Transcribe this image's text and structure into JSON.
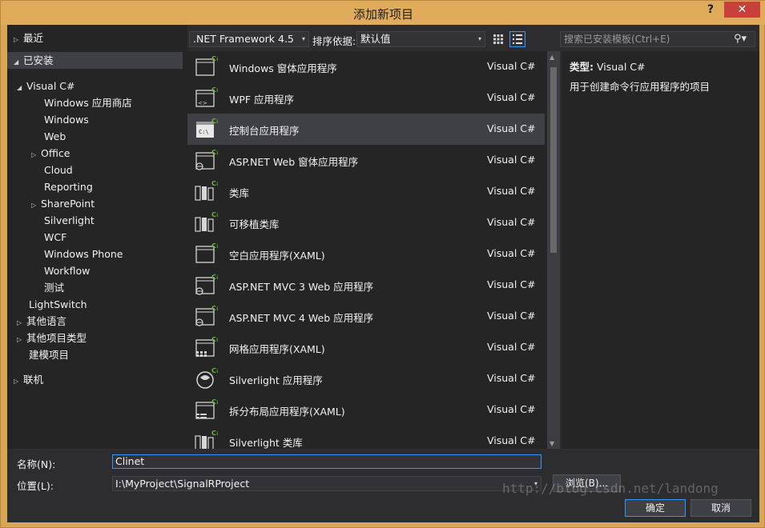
{
  "window": {
    "title": "添加新项目",
    "help": "?",
    "close": "✕"
  },
  "tree": [
    {
      "label": "最近",
      "arrow": "▷"
    },
    {
      "label": "已安装",
      "arrow": "◢"
    },
    {
      "label": "Visual C#",
      "arrow": "◢"
    },
    {
      "label": "Windows 应用商店",
      "arrow": ""
    },
    {
      "label": "Windows",
      "arrow": ""
    },
    {
      "label": "Web",
      "arrow": ""
    },
    {
      "label": "Office",
      "arrow": "▷"
    },
    {
      "label": "Cloud",
      "arrow": ""
    },
    {
      "label": "Reporting",
      "arrow": ""
    },
    {
      "label": "SharePoint",
      "arrow": "▷"
    },
    {
      "label": "Silverlight",
      "arrow": ""
    },
    {
      "label": "WCF",
      "arrow": ""
    },
    {
      "label": "Windows Phone",
      "arrow": ""
    },
    {
      "label": "Workflow",
      "arrow": ""
    },
    {
      "label": "测试",
      "arrow": ""
    },
    {
      "label": "LightSwitch",
      "arrow": ""
    },
    {
      "label": "其他语言",
      "arrow": "▷"
    },
    {
      "label": "其他项目类型",
      "arrow": "▷"
    },
    {
      "label": "建模项目",
      "arrow": ""
    },
    {
      "label": "联机",
      "arrow": "▷"
    }
  ],
  "toolbar": {
    "framework": ".NET Framework 4.5",
    "sort_label": "排序依据:",
    "sort_value": "默认值",
    "search_placeholder": "搜索已安装模板(Ctrl+E)",
    "dropdown_arrow": "▾"
  },
  "templates": [
    {
      "name": "Windows 窗体应用程序",
      "lang": "Visual C#",
      "icon": "windows-form-icon"
    },
    {
      "name": "WPF 应用程序",
      "lang": "Visual C#",
      "icon": "wpf-app-icon"
    },
    {
      "name": "控制台应用程序",
      "lang": "Visual C#",
      "icon": "console-app-icon"
    },
    {
      "name": "ASP.NET Web 窗体应用程序",
      "lang": "Visual C#",
      "icon": "web-form-icon"
    },
    {
      "name": "类库",
      "lang": "Visual C#",
      "icon": "class-library-icon"
    },
    {
      "name": "可移植类库",
      "lang": "Visual C#",
      "icon": "portable-library-icon"
    },
    {
      "name": "空白应用程序(XAML)",
      "lang": "Visual C#",
      "icon": "blank-app-icon"
    },
    {
      "name": "ASP.NET MVC 3 Web 应用程序",
      "lang": "Visual C#",
      "icon": "mvc3-icon"
    },
    {
      "name": "ASP.NET MVC 4 Web 应用程序",
      "lang": "Visual C#",
      "icon": "mvc4-icon"
    },
    {
      "name": "网格应用程序(XAML)",
      "lang": "Visual C#",
      "icon": "grid-app-icon"
    },
    {
      "name": "Silverlight 应用程序",
      "lang": "Visual C#",
      "icon": "silverlight-app-icon"
    },
    {
      "name": "拆分布局应用程序(XAML)",
      "lang": "Visual C#",
      "icon": "split-app-icon"
    },
    {
      "name": "Silverlight 类库",
      "lang": "Visual C#",
      "icon": "silverlight-library-icon"
    }
  ],
  "detail": {
    "type_label": "类型:",
    "type_value": "Visual C#",
    "description": "用于创建命令行应用程序的项目"
  },
  "form": {
    "name_label": "名称(N):",
    "name_value": "Clinet",
    "location_label": "位置(L):",
    "location_value": "I:\\MyProject\\SignalRProject",
    "browse": "浏览(B)...",
    "ok": "确定",
    "cancel": "取消"
  },
  "watermark": "http://blog.csdn.net/landong"
}
